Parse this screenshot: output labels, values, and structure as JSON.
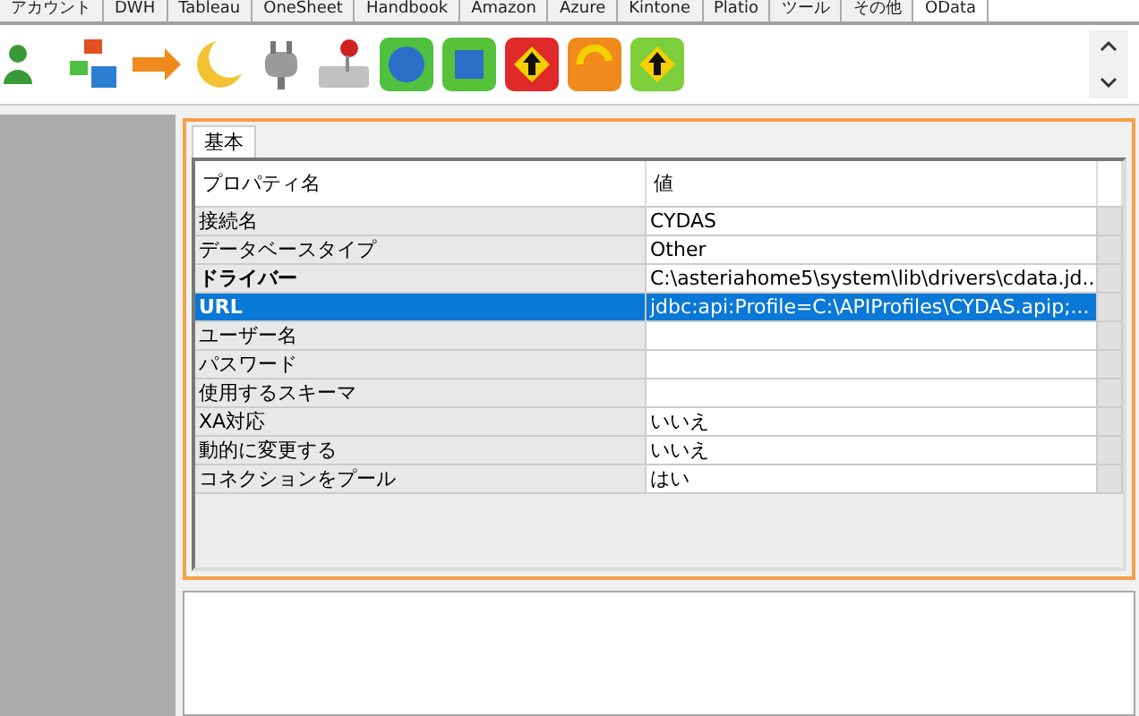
{
  "top_tabs": [
    {
      "label": "アカウント",
      "selected": false
    },
    {
      "label": "DWH",
      "selected": false
    },
    {
      "label": "Tableau",
      "selected": false
    },
    {
      "label": "OneSheet",
      "selected": false
    },
    {
      "label": "Handbook",
      "selected": false
    },
    {
      "label": "Amazon",
      "selected": false
    },
    {
      "label": "Azure",
      "selected": false
    },
    {
      "label": "Kintone",
      "selected": false
    },
    {
      "label": "Platio",
      "selected": false
    },
    {
      "label": "ツール",
      "selected": false
    },
    {
      "label": "その他",
      "selected": false
    },
    {
      "label": "OData",
      "selected": true
    }
  ],
  "toolbar_icons": [
    {
      "kind": "user"
    },
    {
      "kind": "network"
    },
    {
      "kind": "arrows"
    },
    {
      "kind": "moon"
    },
    {
      "kind": "plug"
    },
    {
      "kind": "pin"
    },
    {
      "kind": "globe"
    },
    {
      "kind": "board"
    },
    {
      "kind": "upred"
    },
    {
      "kind": "refresh"
    },
    {
      "kind": "upgreen"
    }
  ],
  "panel_tabs": [
    {
      "label": "基本",
      "selected": true
    }
  ],
  "table": {
    "columns": [
      "プロパティ名",
      "値"
    ],
    "rows": [
      {
        "name": "接続名",
        "value": "CYDAS",
        "bold": false,
        "selected": false
      },
      {
        "name": "データベースタイプ",
        "value": "Other",
        "bold": false,
        "selected": false
      },
      {
        "name": "ドライバー",
        "value": "C:\\asteriahome5\\system\\lib\\drivers\\cdata.jd...",
        "bold": true,
        "selected": false
      },
      {
        "name": "URL",
        "value": "jdbc:api:Profile=C:\\APIProfiles\\CYDAS.apip;...",
        "bold": true,
        "selected": true
      },
      {
        "name": "ユーザー名",
        "value": "",
        "bold": false,
        "selected": false
      },
      {
        "name": "パスワード",
        "value": "",
        "bold": false,
        "selected": false
      },
      {
        "name": "使用するスキーマ",
        "value": "",
        "bold": false,
        "selected": false
      },
      {
        "name": "XA対応",
        "value": "いいえ",
        "bold": false,
        "selected": false
      },
      {
        "name": "動的に変更する",
        "value": "いいえ",
        "bold": false,
        "selected": false
      },
      {
        "name": "コネクションをプール",
        "value": "はい",
        "bold": false,
        "selected": false
      }
    ]
  }
}
